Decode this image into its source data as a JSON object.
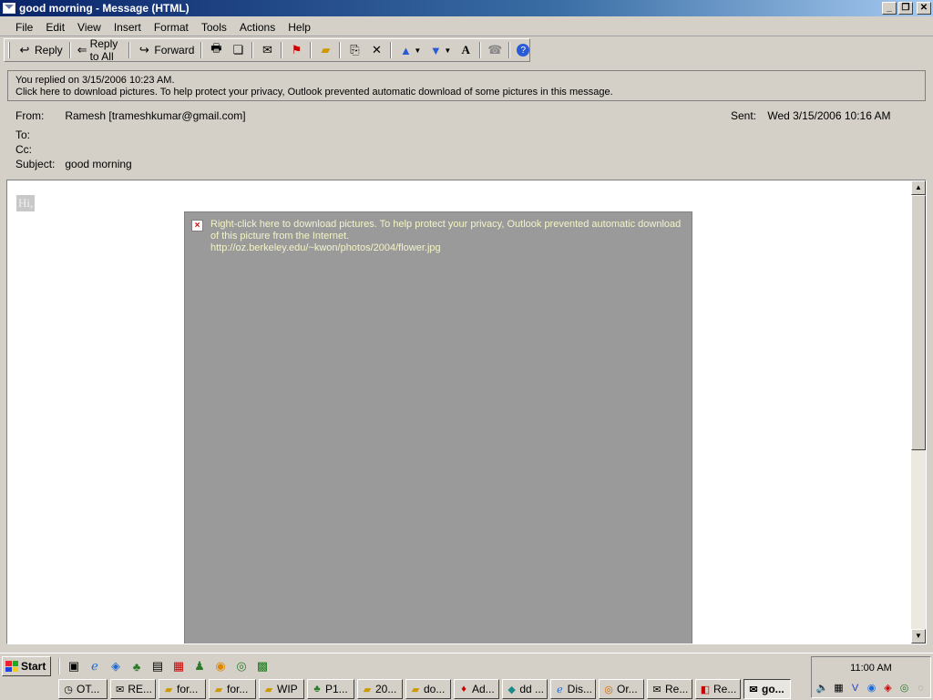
{
  "window": {
    "title": "good morning - Message (HTML)"
  },
  "menu": [
    {
      "label": "File"
    },
    {
      "label": "Edit"
    },
    {
      "label": "View"
    },
    {
      "label": "Insert"
    },
    {
      "label": "Format"
    },
    {
      "label": "Tools"
    },
    {
      "label": "Actions"
    },
    {
      "label": "Help"
    }
  ],
  "toolbar": {
    "reply": "Reply",
    "reply_all": "Reply to All",
    "forward": "Forward"
  },
  "infobar": {
    "line1": "You replied on 3/15/2006 10:23 AM.",
    "line2": "Click here to download pictures. To help protect your privacy, Outlook prevented automatic download of some pictures in this message."
  },
  "header": {
    "from_label": "From:",
    "from_value": "Ramesh  [trameshkumar@gmail.com]",
    "to_label": "To:",
    "cc_label": "Cc:",
    "subject_label": "Subject:",
    "subject_value": "good morning",
    "sent_label": "Sent:",
    "sent_value": "Wed 3/15/2006 10:16 AM"
  },
  "body": {
    "greeting": "Hi,",
    "placeholder_text": "Right-click here to download pictures. To help protect your privacy, Outlook prevented automatic download of this picture from the Internet.",
    "placeholder_url": "http://oz.berkeley.edu/~kwon/photos/2004/flower.jpg"
  },
  "taskbar": {
    "start": "Start",
    "clock": "11:00 AM",
    "tasks": [
      {
        "label": "OT..."
      },
      {
        "label": "RE..."
      },
      {
        "label": "for..."
      },
      {
        "label": "for..."
      },
      {
        "label": "WIP"
      },
      {
        "label": "P1..."
      },
      {
        "label": "20..."
      },
      {
        "label": "do..."
      },
      {
        "label": "Ad..."
      },
      {
        "label": "dd ..."
      },
      {
        "label": "Dis..."
      },
      {
        "label": "Or..."
      },
      {
        "label": "Re..."
      },
      {
        "label": "Re..."
      },
      {
        "label": "go..."
      }
    ]
  }
}
